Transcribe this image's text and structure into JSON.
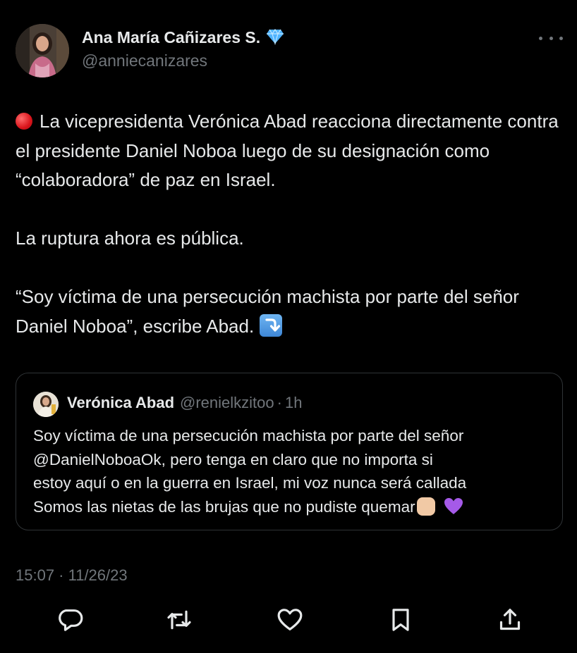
{
  "author": {
    "name": "Ana María Cañizares S.",
    "handle": "@anniecanizares",
    "verified_badge_icon": "diamond-verified-icon"
  },
  "tweet": {
    "paragraphs": [
      "La vicepresidenta Verónica Abad reacciona directamente contra el presidente Daniel Noboa luego de su designación como “colaboradora” de paz en Israel.",
      "La ruptura ahora es pública.",
      "“Soy víctima de una persecución machista por parte del señor Daniel Noboa”, escribe Abad."
    ],
    "lead_icon": "red-circle-icon",
    "trail_icon": "arrow-down-right-icon"
  },
  "quote": {
    "name": "Verónica Abad",
    "handle": "@renielkzitoo",
    "separator": "·",
    "time": "1h",
    "lines": [
      "Soy víctima de una persecución machista por parte del señor",
      "@DanielNoboaOk, pero tenga en claro que no importa si",
      "estoy aquí o en la guerra en Israel, mi voz nunca será callada",
      "Somos las nietas de las brujas que no pudiste quemar"
    ],
    "trail_icons": [
      "raised-fist-icon",
      "purple-heart-icon"
    ]
  },
  "timestamp": "15:07 · 11/26/23",
  "actions": [
    "reply-icon",
    "retweet-icon",
    "like-icon",
    "bookmark-icon",
    "share-icon"
  ],
  "colors": {
    "background": "#000000",
    "text": "#e7e9ea",
    "muted": "#71767b",
    "border": "#2f3336",
    "verified": "#1d9bf0"
  }
}
